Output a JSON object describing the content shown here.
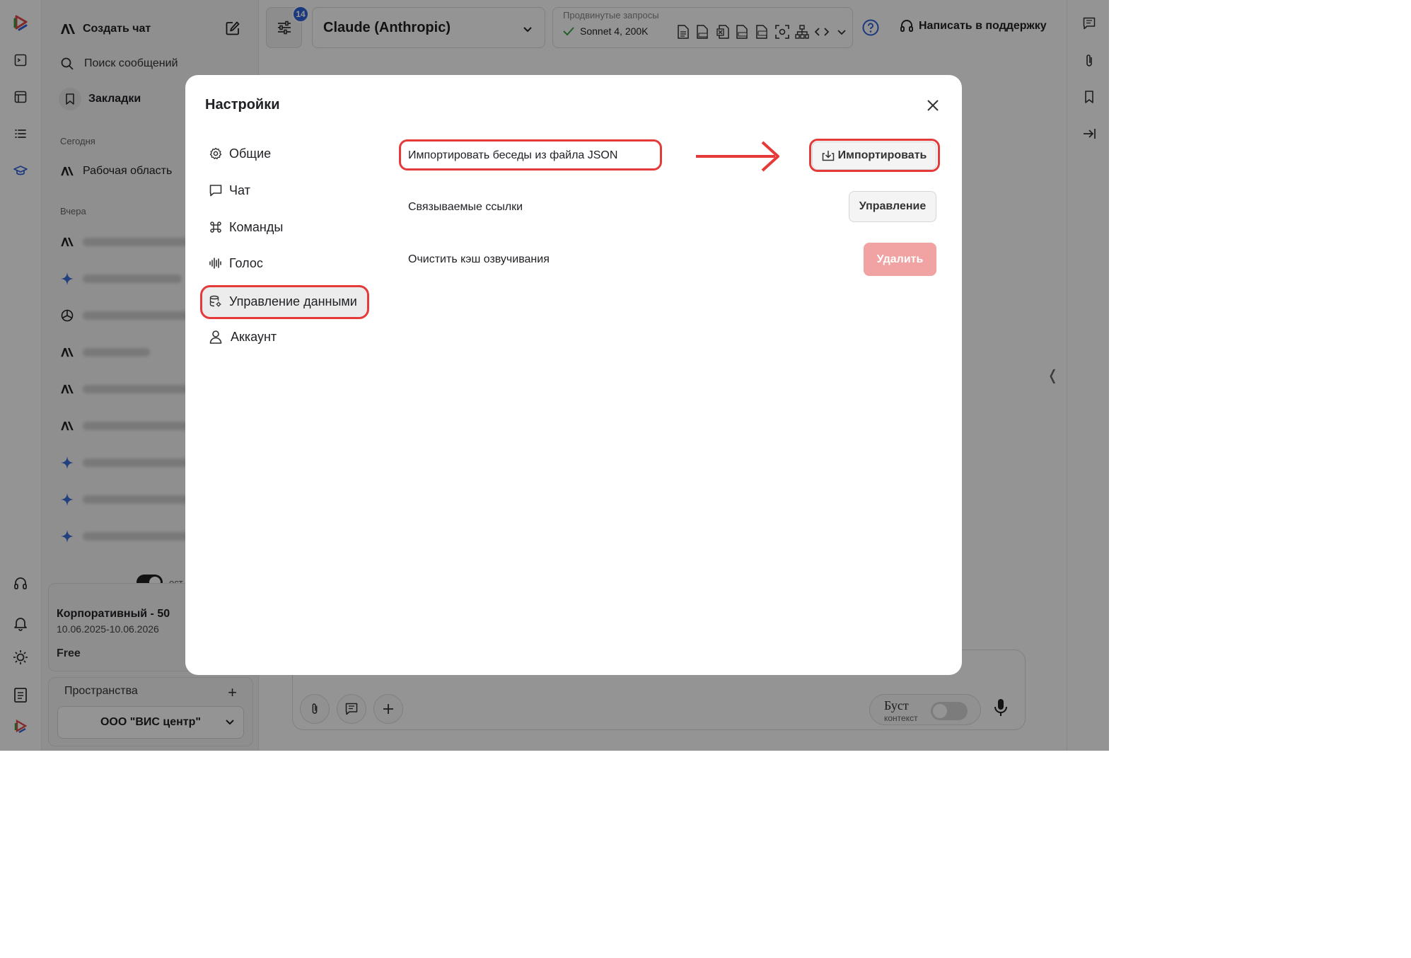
{
  "rail": {
    "icons": [
      "app-logo-icon",
      "terminal-icon",
      "table-icon",
      "list-icon",
      "graduation-cap-icon",
      "headset-icon",
      "bell-icon",
      "sun-icon",
      "clipboard-icon",
      "brand-logo-icon"
    ],
    "accent": "#2f63d9"
  },
  "sidebar": {
    "new_chat": "Создать чат",
    "search_placeholder": "Поиск сообщений",
    "bookmarks": "Закладки",
    "sections": {
      "today": "Сегодня",
      "yesterday": "Вчера"
    },
    "today_items": [
      {
        "label": "Рабочая область",
        "icon": "anthropic-icon"
      }
    ],
    "yesterday_items": [
      {
        "icon": "anthropic-icon"
      },
      {
        "icon": "sparkle-icon"
      },
      {
        "icon": "openai-icon"
      },
      {
        "icon": "anthropic-icon"
      },
      {
        "icon": "anthropic-icon"
      },
      {
        "icon": "anthropic-icon"
      },
      {
        "icon": "sparkle-icon"
      },
      {
        "icon": "sparkle-icon"
      },
      {
        "icon": "sparkle-icon"
      }
    ],
    "toggle_label": "ост",
    "plan": {
      "name": "Корпоративный - 50",
      "dates": "10.06.2025-10.06.2026",
      "tier": "Free"
    },
    "spaces": {
      "title": "Пространства",
      "add": "+",
      "selected": "ООО \"ВИС центр\""
    }
  },
  "topbar": {
    "settings_badge": "14",
    "model": "Claude (Anthropic)",
    "advanced_label": "Продвинутые запросы",
    "advanced_value": "Sonnet 4, 200K",
    "tool_icons": [
      "doc-icon",
      "pdf-icon",
      "excel-icon",
      "csv-icon",
      "docx-icon",
      "screenshot-icon",
      "sitemap-icon",
      "code-icon"
    ],
    "support": "Написать в поддержку"
  },
  "composer": {
    "boost_title": "Буст",
    "boost_sub": "контекст"
  },
  "settings_modal": {
    "title": "Настройки",
    "nav": [
      {
        "label": "Общие",
        "icon": "gear-icon"
      },
      {
        "label": "Чат",
        "icon": "chat-bubble-icon"
      },
      {
        "label": "Команды",
        "icon": "command-icon"
      },
      {
        "label": "Голос",
        "icon": "waveform-icon"
      },
      {
        "label": "Управление данными",
        "icon": "database-settings-icon"
      },
      {
        "label": "Аккаунт",
        "icon": "user-icon"
      }
    ],
    "active_nav": "Управление данными",
    "rows": {
      "import_label": "Импортировать беседы из файла JSON",
      "import_button": "Импортировать",
      "links_label": "Связываемые ссылки",
      "links_button": "Управление",
      "cache_label": "Очистить кэш озвучивания",
      "cache_button": "Удалить"
    },
    "highlight_color": "#e53a3a",
    "danger_color": "#f1a2a2"
  }
}
